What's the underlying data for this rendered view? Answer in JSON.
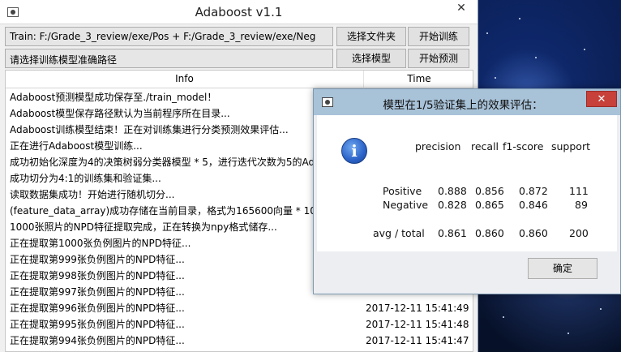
{
  "main_window": {
    "title": "Adaboost v1.1",
    "close_glyph": "✕",
    "train_path": "Train: F:/Grade_3_review/exe/Pos + F:/Grade_3_review/exe/Neg",
    "select_folder_label": "选择文件夹",
    "start_training_label": "开始训练",
    "model_path_placeholder": "请选择训练模型准确路径",
    "select_model_label": "选择模型",
    "start_predict_label": "开始预测"
  },
  "log_table": {
    "columns": [
      "Info",
      "Time"
    ],
    "rows": [
      {
        "info": "Adaboost预测模型成功保存至./train_model！",
        "time": ""
      },
      {
        "info": "Adaboost模型保存路径默认为当前程序所在目录...",
        "time": ""
      },
      {
        "info": "Adaboost训练模型结束！正在对训练集进行分类预测效果评估...",
        "time": ""
      },
      {
        "info": "正在进行Adaboost模型训练...",
        "time": ""
      },
      {
        "info": "成功初始化深度为4的决策树弱分类器模型 * 5，进行迭代次数为5的Adaboost训练...",
        "time": ""
      },
      {
        "info": "成功切分为4:1的训练集和验证集...",
        "time": ""
      },
      {
        "info": "读取数据集成功！开始进行随机切分...",
        "time": ""
      },
      {
        "info": "(feature_data_array)成功存储在当前目录，格式为165600向量 * 1000",
        "time": ""
      },
      {
        "info": "1000张照片的NPD特征提取完成，正在转换为npy格式储存...",
        "time": ""
      },
      {
        "info": "正在提取第1000张负例图片的NPD特征...",
        "time": ""
      },
      {
        "info": "正在提取第999张负例图片的NPD特征...",
        "time": ""
      },
      {
        "info": "正在提取第998张负例图片的NPD特征...",
        "time": ""
      },
      {
        "info": "正在提取第997张负例图片的NPD特征...",
        "time": ""
      },
      {
        "info": "正在提取第996张负例图片的NPD特征...",
        "time": "2017-12-11  15:41:49"
      },
      {
        "info": "正在提取第995张负例图片的NPD特征...",
        "time": "2017-12-11  15:41:48"
      },
      {
        "info": "正在提取第994张负例图片的NPD特征...",
        "time": "2017-12-11  15:41:47"
      }
    ]
  },
  "dialog": {
    "title": "模型在1/5验证集上的效果评估：",
    "close_glyph": "✕",
    "icon": "info-icon",
    "header": [
      "precision",
      "recall",
      "f1-score",
      "support"
    ],
    "rows": [
      {
        "label": "Positive",
        "precision": "0.888",
        "recall": "0.856",
        "f1": "0.872",
        "support": "111"
      },
      {
        "label": "Negative",
        "precision": "0.828",
        "recall": "0.865",
        "f1": "0.846",
        "support": "89"
      },
      {
        "label": "avg / total",
        "precision": "0.861",
        "recall": "0.860",
        "f1": "0.860",
        "support": "200"
      }
    ],
    "ok_label": "确定"
  },
  "colors": {
    "dialog_titlebar": "#a8c2d8",
    "close_red": "#c7403a",
    "info_blue": "#2b63c8"
  }
}
